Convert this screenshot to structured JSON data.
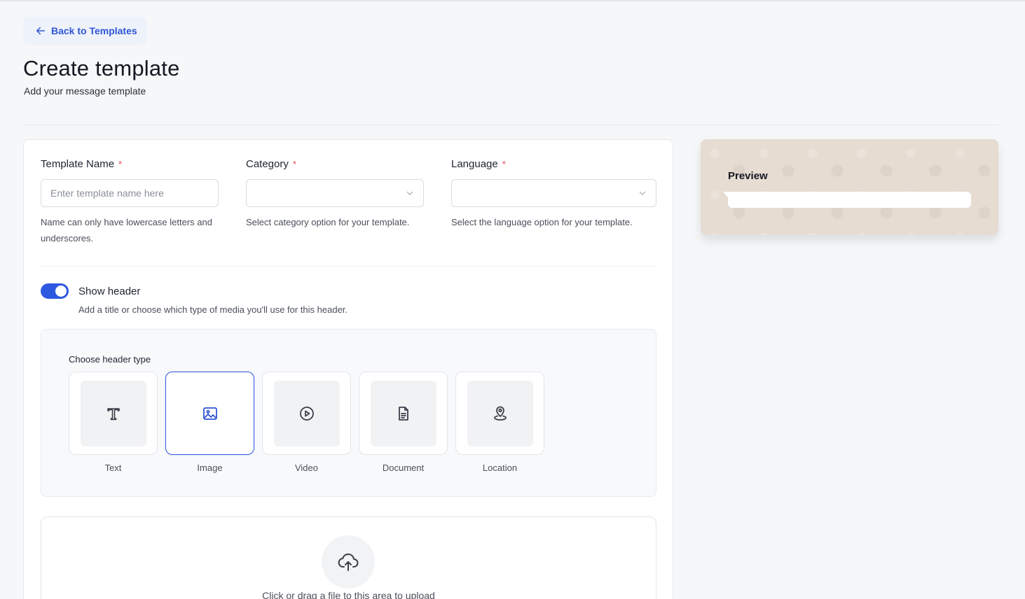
{
  "back_button": {
    "label": "Back to Templates",
    "icon": "arrow-left-icon"
  },
  "page": {
    "title": "Create template",
    "subtitle": "Add your message template"
  },
  "form": {
    "template_name": {
      "label": "Template Name",
      "required_mark": "*",
      "placeholder": "Enter template name here",
      "value": "",
      "help": "Name can only have lowercase letters and underscores."
    },
    "category": {
      "label": "Category",
      "required_mark": "*",
      "selected": "",
      "help": "Select category option for your template."
    },
    "language": {
      "label": "Language",
      "required_mark": "*",
      "selected": "",
      "help": "Select the language option for your template."
    },
    "show_header": {
      "label": "Show header",
      "enabled": true,
      "help": "Add a title or choose which type of media you'll use for this header."
    },
    "header_type": {
      "label": "Choose header type",
      "selected": "Image",
      "options": [
        {
          "label": "Text",
          "icon": "text-icon"
        },
        {
          "label": "Image",
          "icon": "image-icon"
        },
        {
          "label": "Video",
          "icon": "video-play-icon"
        },
        {
          "label": "Document",
          "icon": "document-icon"
        },
        {
          "label": "Location",
          "icon": "location-pin-icon"
        }
      ]
    },
    "upload": {
      "text": "Click or drag a file to this area to upload",
      "icon": "cloud-upload-icon"
    }
  },
  "preview": {
    "title": "Preview"
  },
  "colors": {
    "accent": "#2e58e0",
    "required": "#e5484d",
    "preview_bg": "#e6dcd2"
  }
}
